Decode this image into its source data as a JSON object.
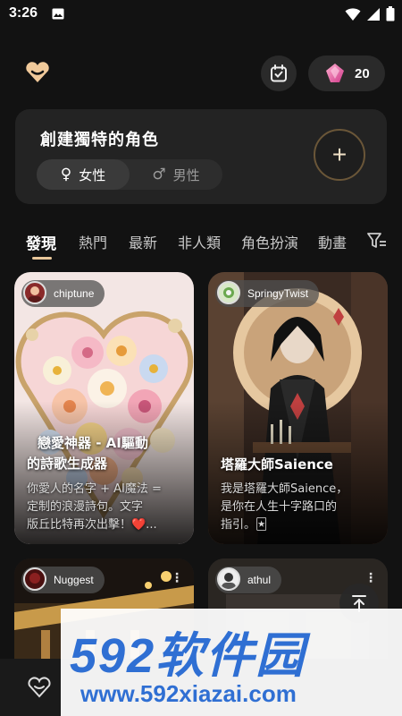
{
  "status_bar": {
    "time": "3:26"
  },
  "header": {
    "gem_count": "20"
  },
  "create_card": {
    "title": "創建獨特的角色",
    "female_label": "女性",
    "male_label": "男性",
    "female_symbol": "♀",
    "male_symbol": "♂",
    "add_symbol": "+"
  },
  "tabs": [
    "發現",
    "熱門",
    "最新",
    "非人類",
    "角色扮演",
    "動畫"
  ],
  "cards": [
    {
      "author": "chiptune",
      "title_line1": "戀愛神器 - AI驅動",
      "title_line2": "的詩歌生成器",
      "desc_line1": "你愛人的名字 + AI魔法 =",
      "desc_line2": "定制的浪漫詩句。文字",
      "desc_line3": "版丘比特再次出擊！❤️...",
      "more": "⋮"
    },
    {
      "author": "SpringyTwist",
      "title_line1": "塔羅大師Saience",
      "desc_line1": "我是塔羅大師Saience，",
      "desc_line2": "是你在人生十字路口的",
      "desc_line3": "指引。🃏",
      "more": "⋮"
    },
    {
      "author": "Nuggest",
      "more": "⋮"
    },
    {
      "author": "athul",
      "more": "⋮"
    }
  ],
  "watermark": {
    "big": "592软件园",
    "url": "www.592xiazai.com"
  },
  "colors": {
    "accent": "#e9c79a",
    "background": "#121212",
    "card": "#232323",
    "watermark_blue": "#2f6fd3"
  }
}
